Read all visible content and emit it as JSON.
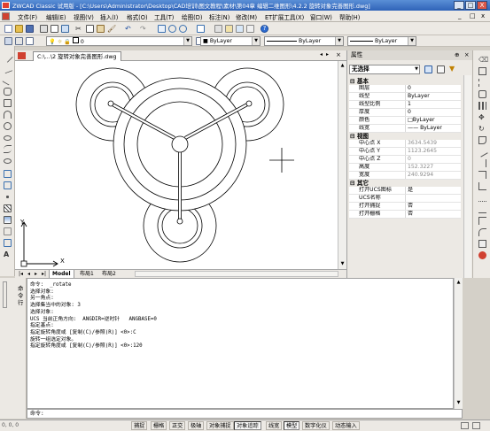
{
  "window": {
    "title": "ZWCAD Classic 试用版 - [C:\\Users\\Administrator\\Desktop\\CAD培训\\图文教程\\素材\\第04章 编辑二维图形\\4.2.2  旋转对象完善图形.dwg]",
    "min_label": "_",
    "max_label": "□",
    "close_label": "X"
  },
  "menu": {
    "items": [
      "文件(F)",
      "编辑(E)",
      "视图(V)",
      "插入(I)",
      "格式(O)",
      "工具(T)",
      "绘图(D)",
      "标注(N)",
      "修改(M)",
      "ET扩展工具(X)",
      "窗口(W)",
      "帮助(H)"
    ],
    "doc_min": "_",
    "doc_max": "□",
    "doc_close": "x"
  },
  "toolbar": {
    "layer_value": "0",
    "color_value": "■ ByLayer",
    "linetype_value": "ByLayer",
    "lineweight_value": "ByLayer"
  },
  "drawing": {
    "doc_tab": "C:\\...\\2  旋转对象完善图形.dwg",
    "ucs_y": "Y",
    "ucs_x": "X",
    "layout_tabs": [
      "Model",
      "布局1",
      "布局2"
    ]
  },
  "properties": {
    "title": "属性",
    "selection": "无选择",
    "sections": [
      {
        "name": "基本",
        "rows": [
          {
            "k": "图层",
            "v": "0"
          },
          {
            "k": "线型",
            "v": "ByLayer"
          },
          {
            "k": "线型比例",
            "v": "1"
          },
          {
            "k": "厚度",
            "v": "0"
          },
          {
            "k": "颜色",
            "v": "□ByLayer"
          },
          {
            "k": "线宽",
            "v": "—— ByLayer"
          }
        ]
      },
      {
        "name": "视图",
        "rows": [
          {
            "k": "中心点 X",
            "v": "3634.5439",
            "gray": true
          },
          {
            "k": "中心点 Y",
            "v": "1123.2645",
            "gray": true
          },
          {
            "k": "中心点 Z",
            "v": "0",
            "gray": true
          },
          {
            "k": "高度",
            "v": "152.3227",
            "gray": true
          },
          {
            "k": "宽度",
            "v": "240.9294",
            "gray": true
          }
        ]
      },
      {
        "name": "其它",
        "rows": [
          {
            "k": "打开UCS图标",
            "v": "是"
          },
          {
            "k": "UCS名称",
            "v": ""
          },
          {
            "k": "打开捕捉",
            "v": "否"
          },
          {
            "k": "打开栅格",
            "v": "否"
          }
        ]
      }
    ]
  },
  "command": {
    "side_label": "命令行",
    "history": [
      "命令:  _rotate",
      "选择对象:",
      "另一角点:",
      "选择集当中的对象: 3",
      "选择对象:",
      "UCS 当前正角方向:  ANGDIR=逆时针   ANGBASE=0",
      "指定基点:",
      "指定旋转角度或 [复制(C)/参照(R)] <0>:C",
      "旋转一组选定对象。",
      "指定旋转角度或 [复制(C)/参照(R)] <0>:120"
    ],
    "prompt": "命令:"
  },
  "status": {
    "coords": "0, 0, 0",
    "buttons": [
      "捕捉",
      "栅格",
      "正交",
      "极轴",
      "对象捕捉",
      "对象追踪",
      "线宽",
      "模型",
      "数字化仪",
      "动态输入"
    ],
    "active": [
      "对象追踪",
      "模型"
    ]
  },
  "colors": {
    "titlebar": "#2f63b8",
    "panel": "#ece9e4",
    "canvas": "#ffffff"
  }
}
